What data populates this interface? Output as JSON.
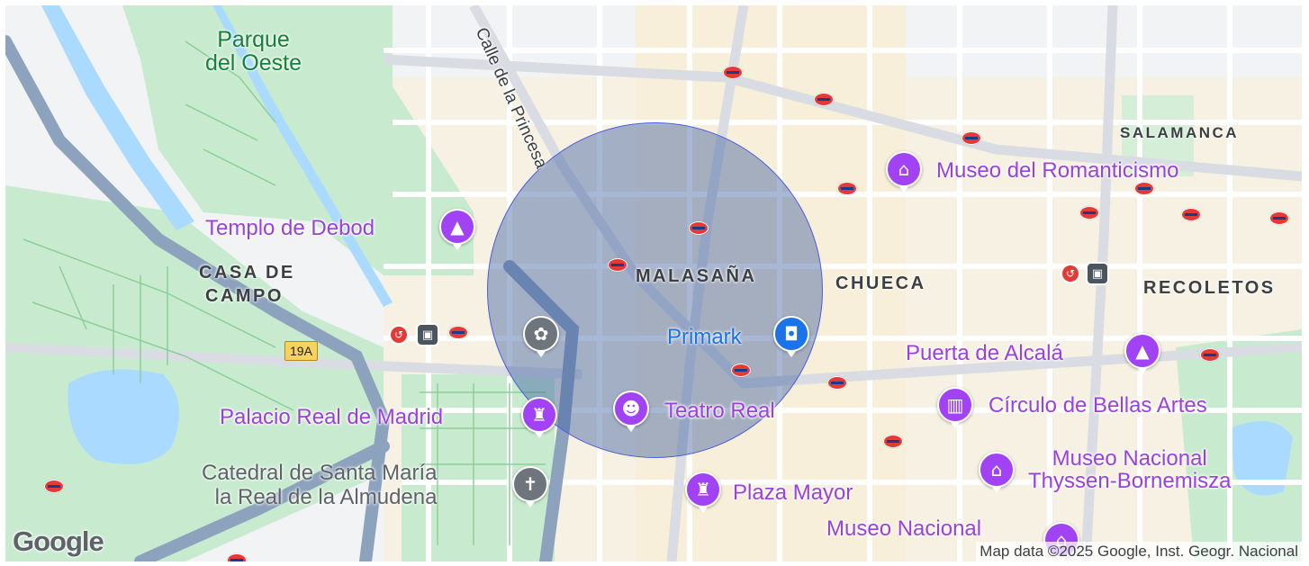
{
  "map": {
    "attribution": "Map data ©2025 Google, Inst. Geogr. Nacional",
    "logo": "Google",
    "colors": {
      "park": "#c8ebcf",
      "water": "#aadaff",
      "road": "#ffffff",
      "highway": "#8da3bd",
      "radius_fill": "#3e5fa0",
      "poi": "#a142f4",
      "shop": "#1a73e8"
    },
    "neighborhoods": [
      "SALAMANCA",
      "MALASAÑA",
      "CHUECA",
      "RECOLETOS",
      "CASA DE",
      "CAMPO"
    ],
    "park_label": {
      "line1": "Parque",
      "line2": "del Oeste"
    },
    "street_label": "Calle de la Princesa",
    "road_shield": "19A",
    "places": {
      "museo_romanticismo": "Museo del Romanticismo",
      "templo_debod": "Templo de Debod",
      "primark": "Primark",
      "puerta_alcala": "Puerta de Alcalá",
      "circulo_bellas_artes": "Círculo de Bellas Artes",
      "teatro_real": "Teatro Real",
      "palacio_real": "Palacio Real de Madrid",
      "catedral_line1": "Catedral de Santa María",
      "catedral_line2": "la Real de la Almudena",
      "plaza_mayor": "Plaza Mayor",
      "thyssen_line1": "Museo Nacional",
      "thyssen_line2": "Thyssen-Bornemisza",
      "museo_nacional_bottom": "Museo Nacional"
    },
    "icons": {
      "museum": "museum-icon",
      "monument": "monument-icon",
      "shopping": "shopping-bag-icon",
      "theater": "theater-masks-icon",
      "castle": "castle-icon",
      "church": "church-icon",
      "garden": "garden-icon",
      "metro": "metro-station-icon",
      "train": "train-station-icon",
      "cercanias": "cercanias-icon"
    }
  }
}
